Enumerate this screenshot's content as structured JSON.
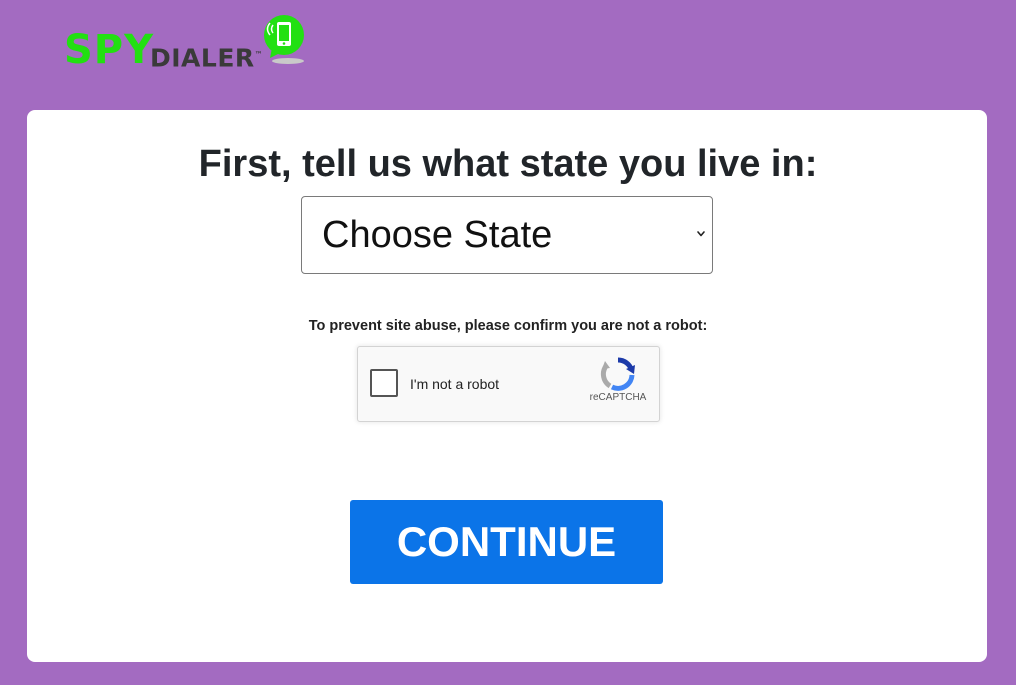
{
  "logo": {
    "brand_primary": "SPY",
    "brand_secondary": "DIALER",
    "trademark": "™",
    "icon": "phone-chat-bubble-icon"
  },
  "form": {
    "heading": "First, tell us what state you live in:",
    "state_select": {
      "selected": "Choose State",
      "icon": "chevron-down-icon"
    },
    "robot_note": "To prevent site abuse, please confirm you are not a robot:",
    "recaptcha": {
      "label": "I'm not a robot",
      "brand": "reCAPTCHA",
      "checked": false,
      "icon": "recaptcha-icon"
    },
    "continue_label": "CONTINUE"
  },
  "colors": {
    "background": "#a36bc1",
    "card": "#ffffff",
    "button": "#0b74e8",
    "brand_green": "#22e012",
    "brand_dark": "#3a3a3a"
  }
}
